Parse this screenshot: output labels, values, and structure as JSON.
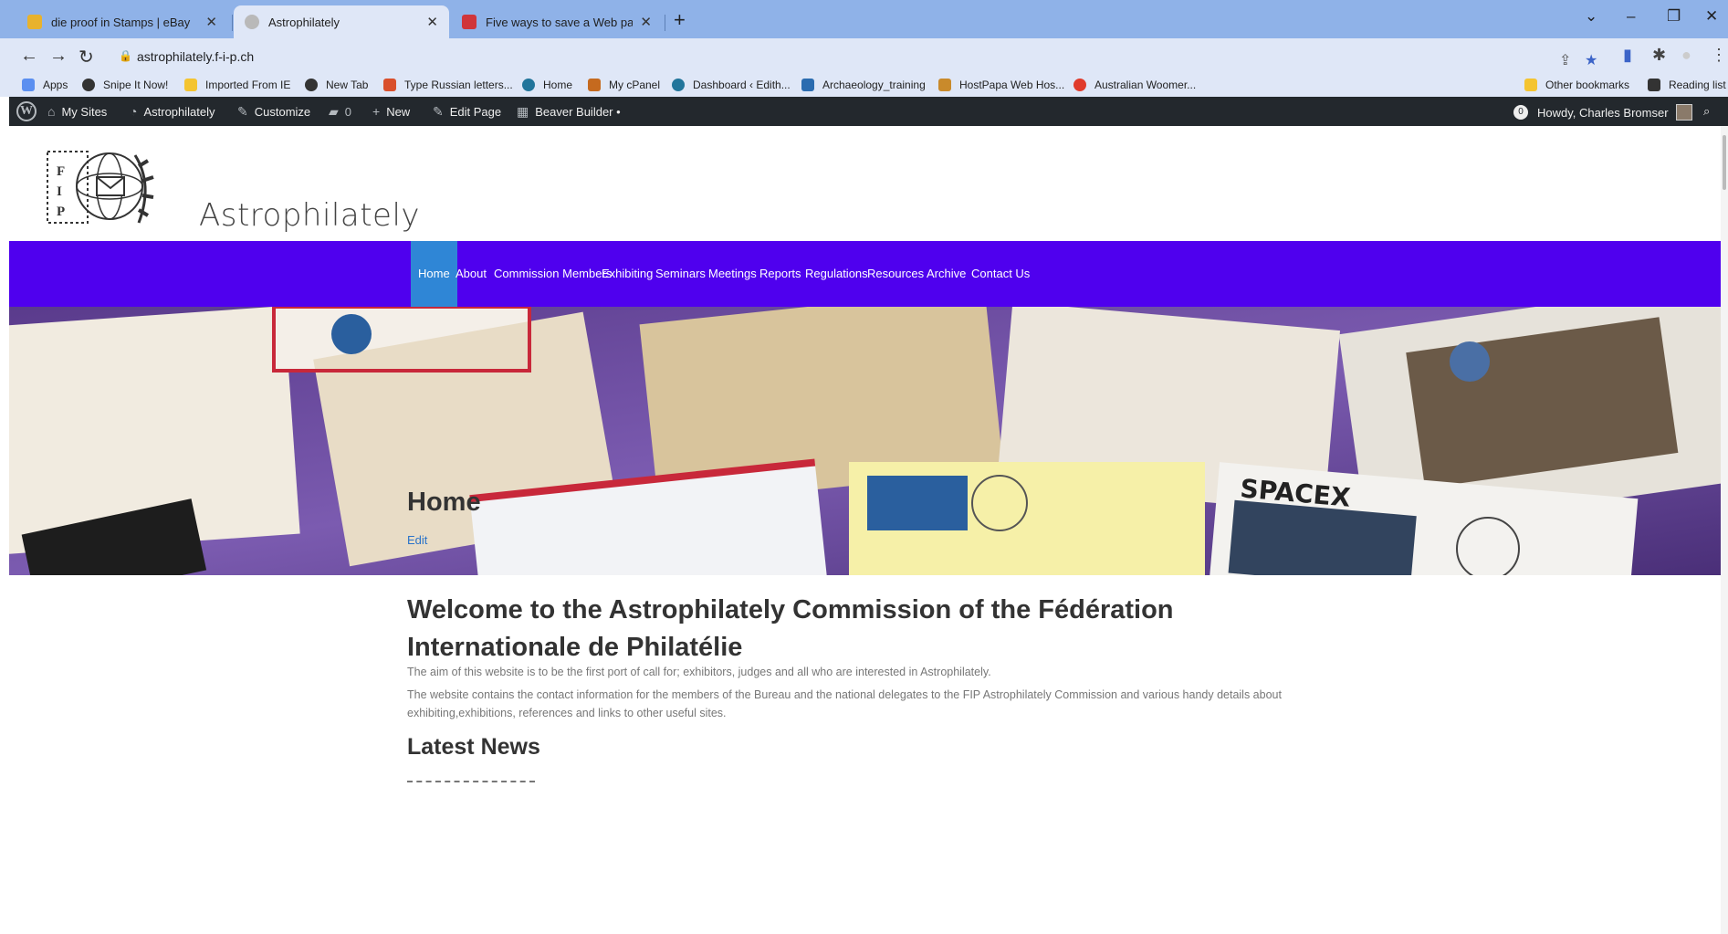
{
  "browser": {
    "tabs": [
      {
        "title": "die proof in Stamps | eBay",
        "active": false,
        "color": "#e8b22d"
      },
      {
        "title": "Astrophilately",
        "active": true,
        "color": "#8e8e8e"
      },
      {
        "title": "Five ways to save a Web page - \u0007",
        "active": false,
        "color": "#d0353a"
      }
    ],
    "url": "astrophilately.f-i-p.ch",
    "bookmarks": [
      {
        "label": "Apps",
        "color": "#5b8ff0"
      },
      {
        "label": "Snipe It Now!",
        "color": "#333333"
      },
      {
        "label": "Imported From IE",
        "color": "#f4c430"
      },
      {
        "label": "New Tab",
        "color": "#333333"
      },
      {
        "label": "Type Russian letters...",
        "color": "#d9502c"
      },
      {
        "label": "Home",
        "color": "#21759b"
      },
      {
        "label": "My cPanel",
        "color": "#c56a1f"
      },
      {
        "label": "Dashboard ‹ Edith...",
        "color": "#21759b"
      },
      {
        "label": "Archaeology_training",
        "color": "#2b6cb0"
      },
      {
        "label": "HostPapa Web Hos...",
        "color": "#c98a2b"
      },
      {
        "label": "Australian Woomer...",
        "color": "#e03b2b"
      }
    ],
    "bookmarks_right": [
      {
        "label": "Other bookmarks",
        "color": "#f4c430"
      },
      {
        "label": "Reading list",
        "color": "#333333"
      }
    ]
  },
  "wp_admin": {
    "my_sites": "My Sites",
    "site": "Astrophilately",
    "customize": "Customize",
    "comments": "0",
    "new": "New",
    "edit_page": "Edit Page",
    "beaver": "Beaver Builder •",
    "notification_count": "0",
    "howdy": "Howdy, Charles Bromser"
  },
  "site": {
    "title": "Astrophilately",
    "nav": [
      "Home",
      "About",
      "Commission Members",
      "Exhibiting",
      "Seminars",
      "Meetings",
      "Reports",
      "Regulations",
      "Resources",
      "Archive",
      "Contact Us"
    ],
    "nav_color": "#4f00ee",
    "nav_active_color": "#2f86d6"
  },
  "content": {
    "heading": "Home",
    "edit": "Edit",
    "welcome": "Welcome to the Astrophilately Commission of the Fédération Internationale de Philatélie",
    "para1": "The aim of this website is to be the first port of call for; exhibitors, judges and all who are interested in Astrophilately.",
    "para2": "The website contains the contact information for the members of the Bureau and the national delegates to the FIP Astrophilately Commission and various handy details about exhibiting,exhibitions, references and links to other useful sites.",
    "latest_news": "Latest News"
  }
}
